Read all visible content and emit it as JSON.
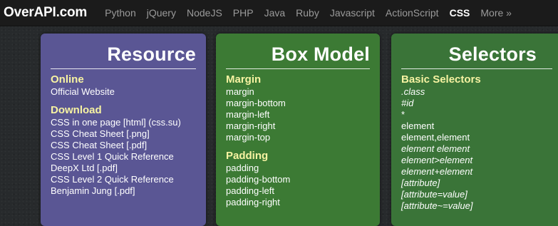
{
  "header": {
    "brand": "OverAPI.com",
    "nav": [
      "Python",
      "jQuery",
      "NodeJS",
      "PHP",
      "Java",
      "Ruby",
      "Javascript",
      "ActionScript",
      "CSS",
      "More »"
    ],
    "active": "CSS"
  },
  "cards": [
    {
      "title": "Resource",
      "sections": [
        {
          "heading": "Online",
          "items": [
            "Official Website"
          ]
        },
        {
          "heading": "Download",
          "items": [
            "CSS in one page [html] (css.su)",
            "CSS Cheat Sheet [.png]",
            "CSS Cheat Sheet [.pdf]",
            "CSS Level 1 Quick Reference",
            "DeepX Ltd [.pdf]",
            "CSS Level 2 Quick Reference",
            "Benjamin Jung [.pdf]"
          ]
        }
      ]
    },
    {
      "title": "Box Model",
      "sections": [
        {
          "heading": "Margin",
          "items": [
            "margin",
            "margin-bottom",
            "margin-left",
            "margin-right",
            "margin-top"
          ]
        },
        {
          "heading": "Padding",
          "items": [
            "padding",
            "padding-bottom",
            "padding-left",
            "padding-right"
          ]
        }
      ]
    },
    {
      "title": "Selectors",
      "sections": [
        {
          "heading": "Basic Selectors",
          "items": [
            ".class",
            "#id",
            "*",
            "element",
            "element,element",
            "element element",
            "element>element",
            "element+element",
            "[attribute]",
            "[attribute=value]",
            "[attribute~=value]"
          ]
        }
      ]
    }
  ],
  "colors": {
    "topbar": "#1b1b1b",
    "resource_card": "#5a5694",
    "box_model_card": "#3c7a34",
    "selectors_card": "#3a7438",
    "section_heading": "#f7f3a2"
  }
}
